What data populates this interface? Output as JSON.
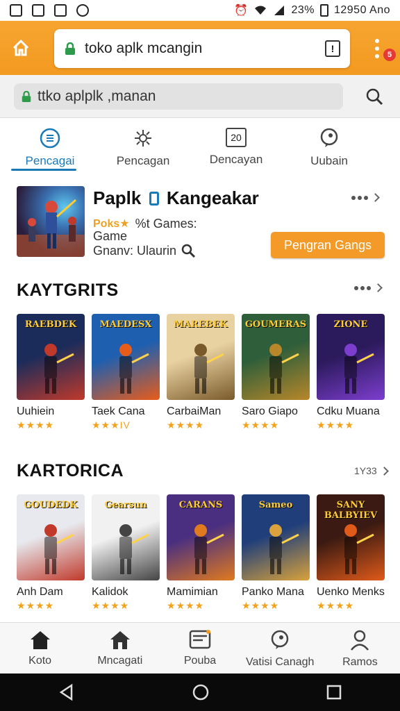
{
  "status": {
    "time": "12950 Ano",
    "battery": "23%"
  },
  "browser": {
    "url_text": "toko aplk mcangin",
    "notification_count": "5"
  },
  "search": {
    "text": "ttko aplplk ,manan"
  },
  "tabs": [
    {
      "label": "Pencagai",
      "icon": "list-icon",
      "active": true
    },
    {
      "label": "Pencagan",
      "icon": "settings-icon",
      "active": false
    },
    {
      "label": "Dencayan",
      "icon": "calendar-icon",
      "badge": "20",
      "active": false
    },
    {
      "label": "Uubain",
      "icon": "chat-icon",
      "active": false
    }
  ],
  "featured": {
    "title": "Paplk",
    "title2": "Kangeakar",
    "rating_label": "Poks★",
    "meta1": "%t Games:",
    "meta2": "Game",
    "meta3": "Gnanv: Ulaurin",
    "button": "Pengran Gangs"
  },
  "section1": {
    "title": "KAYTGRITS",
    "items": [
      {
        "name": "Uuhiein",
        "stars": "★★★★",
        "thumb_text": "RAEBDEK",
        "c1": "#1c2c5a",
        "c2": "#c0392b"
      },
      {
        "name": "Taek Cana",
        "stars": "★★★IV",
        "thumb_text": "MAEDESX",
        "c1": "#1e5fb0",
        "c2": "#e85c1a"
      },
      {
        "name": "CarbaiMan",
        "stars": "★★★★",
        "thumb_text": "MAREBEK",
        "c1": "#e9d2a2",
        "c2": "#7a5a2a"
      },
      {
        "name": "Saro Giapo",
        "stars": "★★★★",
        "thumb_text": "GOUMERAS",
        "c1": "#2f5e3a",
        "c2": "#b8872a"
      },
      {
        "name": "Cdku Muana",
        "stars": "★★★★",
        "thumb_text": "ZIONE",
        "c1": "#2b1a5c",
        "c2": "#7d3ecf"
      }
    ]
  },
  "section2": {
    "title": "KARTORICA",
    "more": "1Y33",
    "items": [
      {
        "name": "Anh Dam",
        "stars": "★★★★",
        "thumb_text": "GOUDEDK",
        "c1": "#e7e9ee",
        "c2": "#c0392b"
      },
      {
        "name": "Kalidok",
        "stars": "★★★★",
        "thumb_text": "Gearsun",
        "c1": "#f1f1f1",
        "c2": "#444444"
      },
      {
        "name": "Mamimian",
        "stars": "★★★★",
        "thumb_text": "CARANS",
        "c1": "#4a2f80",
        "c2": "#e07a1f"
      },
      {
        "name": "Panko Mana",
        "stars": "★★★★",
        "thumb_text": "Sameo",
        "c1": "#1f3e7a",
        "c2": "#d9a23c"
      },
      {
        "name": "Uenko Menks",
        "stars": "★★★★",
        "thumb_text": "SANY BALBYIEV",
        "c1": "#3a1a12",
        "c2": "#e05a1a"
      }
    ]
  },
  "bottom_nav": [
    {
      "label": "Koto",
      "icon": "home-icon"
    },
    {
      "label": "Mncagati",
      "icon": "store-icon"
    },
    {
      "label": "Pouba",
      "icon": "apps-icon"
    },
    {
      "label": "Vatisi Canagh",
      "icon": "chat-icon"
    },
    {
      "label": "Ramos",
      "icon": "profile-icon"
    }
  ],
  "colors": {
    "accent": "#f39a20",
    "link": "#1a7ab8",
    "star": "#f4a21c"
  }
}
